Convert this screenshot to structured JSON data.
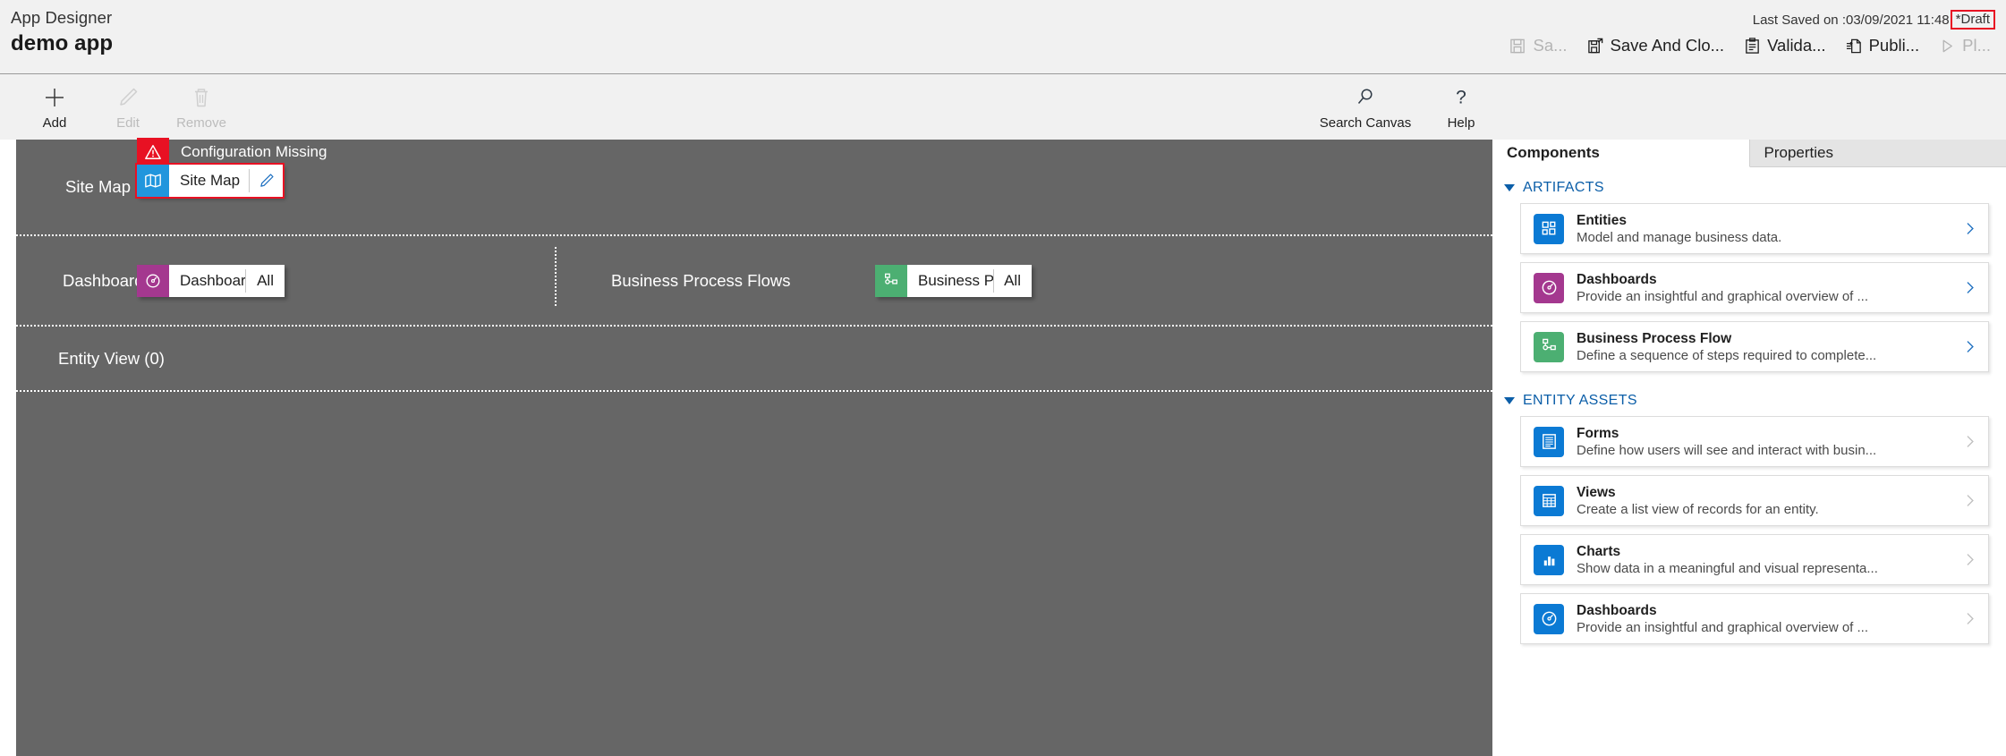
{
  "header": {
    "product_label": "App Designer",
    "app_name": "demo app",
    "last_saved": "Last Saved on :03/09/2021 11:48",
    "draft_badge": "*Draft",
    "commands": [
      {
        "label": "Sa...",
        "icon": "save-icon",
        "disabled": true
      },
      {
        "label": "Save And Clo...",
        "icon": "save-and-close-icon",
        "disabled": false
      },
      {
        "label": "Valida...",
        "icon": "validate-icon",
        "disabled": false
      },
      {
        "label": "Publi...",
        "icon": "publish-icon",
        "disabled": false
      },
      {
        "label": "Pl...",
        "icon": "play-icon",
        "disabled": true
      }
    ]
  },
  "ribbon": {
    "left": [
      {
        "label": "Add",
        "icon": "plus-icon",
        "disabled": false
      },
      {
        "label": "Edit",
        "icon": "pencil-icon",
        "disabled": true
      },
      {
        "label": "Remove",
        "icon": "trash-icon",
        "disabled": true
      }
    ],
    "right": [
      {
        "label": "Search Canvas",
        "icon": "search-icon",
        "disabled": false
      },
      {
        "label": "Help",
        "icon": "question-icon",
        "disabled": false
      }
    ]
  },
  "canvas": {
    "sitemap": {
      "row_label": "Site Map",
      "warning_text": "Configuration Missing",
      "warning_icon": "warning-triangle-icon",
      "tile_icon": "sitemap-icon",
      "tile_name": "Site Map",
      "edit_icon": "pencil-icon",
      "icon_color": "#2196dd",
      "highlight_color": "#e81123"
    },
    "dashboards": {
      "row_label": "Dashboards",
      "tile_icon": "dashboard-gauge-icon",
      "tile_name": "Dashboards",
      "tile_tail": "All",
      "icon_color": "#a4388f"
    },
    "business_process_flows": {
      "row_label": "Business Process Flows",
      "tile_icon": "process-flow-icon",
      "tile_name": "Business Proces...",
      "tile_tail": "All",
      "icon_color": "#4caf72"
    },
    "entity_view": {
      "row_label": "Entity View (0)"
    }
  },
  "right_panel": {
    "tabs": [
      {
        "label": "Components",
        "active": true
      },
      {
        "label": "Properties",
        "active": false
      }
    ],
    "groups": [
      {
        "title": "ARTIFACTS",
        "expanded": true,
        "cards": [
          {
            "title": "Entities",
            "subtitle": "Model and manage business data.",
            "icon": "entities-icon",
            "color": "#0b7ad4",
            "chevron_enabled": true
          },
          {
            "title": "Dashboards",
            "subtitle": "Provide an insightful and graphical overview of ...",
            "icon": "dashboard-gauge-icon",
            "color": "#a4388f",
            "chevron_enabled": true
          },
          {
            "title": "Business Process Flow",
            "subtitle": "Define a sequence of steps required to complete...",
            "icon": "process-flow-icon",
            "color": "#4caf72",
            "chevron_enabled": true
          }
        ]
      },
      {
        "title": "ENTITY ASSETS",
        "expanded": true,
        "cards": [
          {
            "title": "Forms",
            "subtitle": "Define how users will see and interact with busin...",
            "icon": "forms-icon",
            "color": "#0b7ad4",
            "chevron_enabled": false
          },
          {
            "title": "Views",
            "subtitle": "Create a list view of records for an entity.",
            "icon": "views-grid-icon",
            "color": "#0b7ad4",
            "chevron_enabled": false
          },
          {
            "title": "Charts",
            "subtitle": "Show data in a meaningful and visual representa...",
            "icon": "charts-bar-icon",
            "color": "#0b7ad4",
            "chevron_enabled": false
          },
          {
            "title": "Dashboards",
            "subtitle": "Provide an insightful and graphical overview of ...",
            "icon": "dashboard-gauge-icon",
            "color": "#0b7ad4",
            "chevron_enabled": false
          }
        ]
      }
    ]
  }
}
